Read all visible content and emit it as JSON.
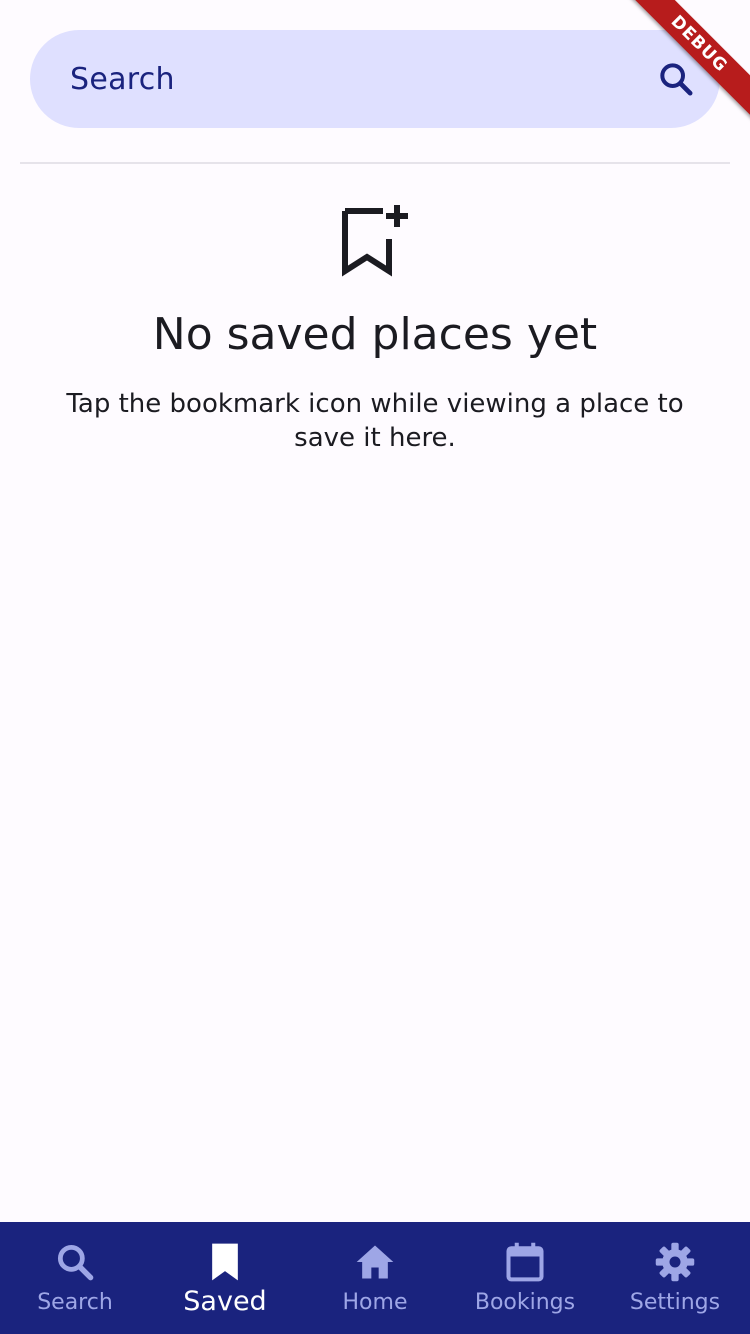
{
  "search": {
    "placeholder": "Search"
  },
  "empty_state": {
    "icon": "bookmark-add-icon",
    "title": "No saved places yet",
    "description": "Tap the bookmark icon while viewing a place to save it here."
  },
  "bottom_nav": {
    "items": [
      {
        "label": "Search",
        "icon": "search-icon",
        "active": false
      },
      {
        "label": "Saved",
        "icon": "bookmark-icon",
        "active": true
      },
      {
        "label": "Home",
        "icon": "home-icon",
        "active": false
      },
      {
        "label": "Bookings",
        "icon": "calendar-icon",
        "active": false
      },
      {
        "label": "Settings",
        "icon": "gear-icon",
        "active": false
      }
    ]
  },
  "debug_banner": "DEBUG",
  "colors": {
    "primary": "#1a237e",
    "search_bg": "#dfe0ff",
    "nav_inactive": "#9ea6e6",
    "background": "#fefbff",
    "debug": "#b71c1c"
  }
}
